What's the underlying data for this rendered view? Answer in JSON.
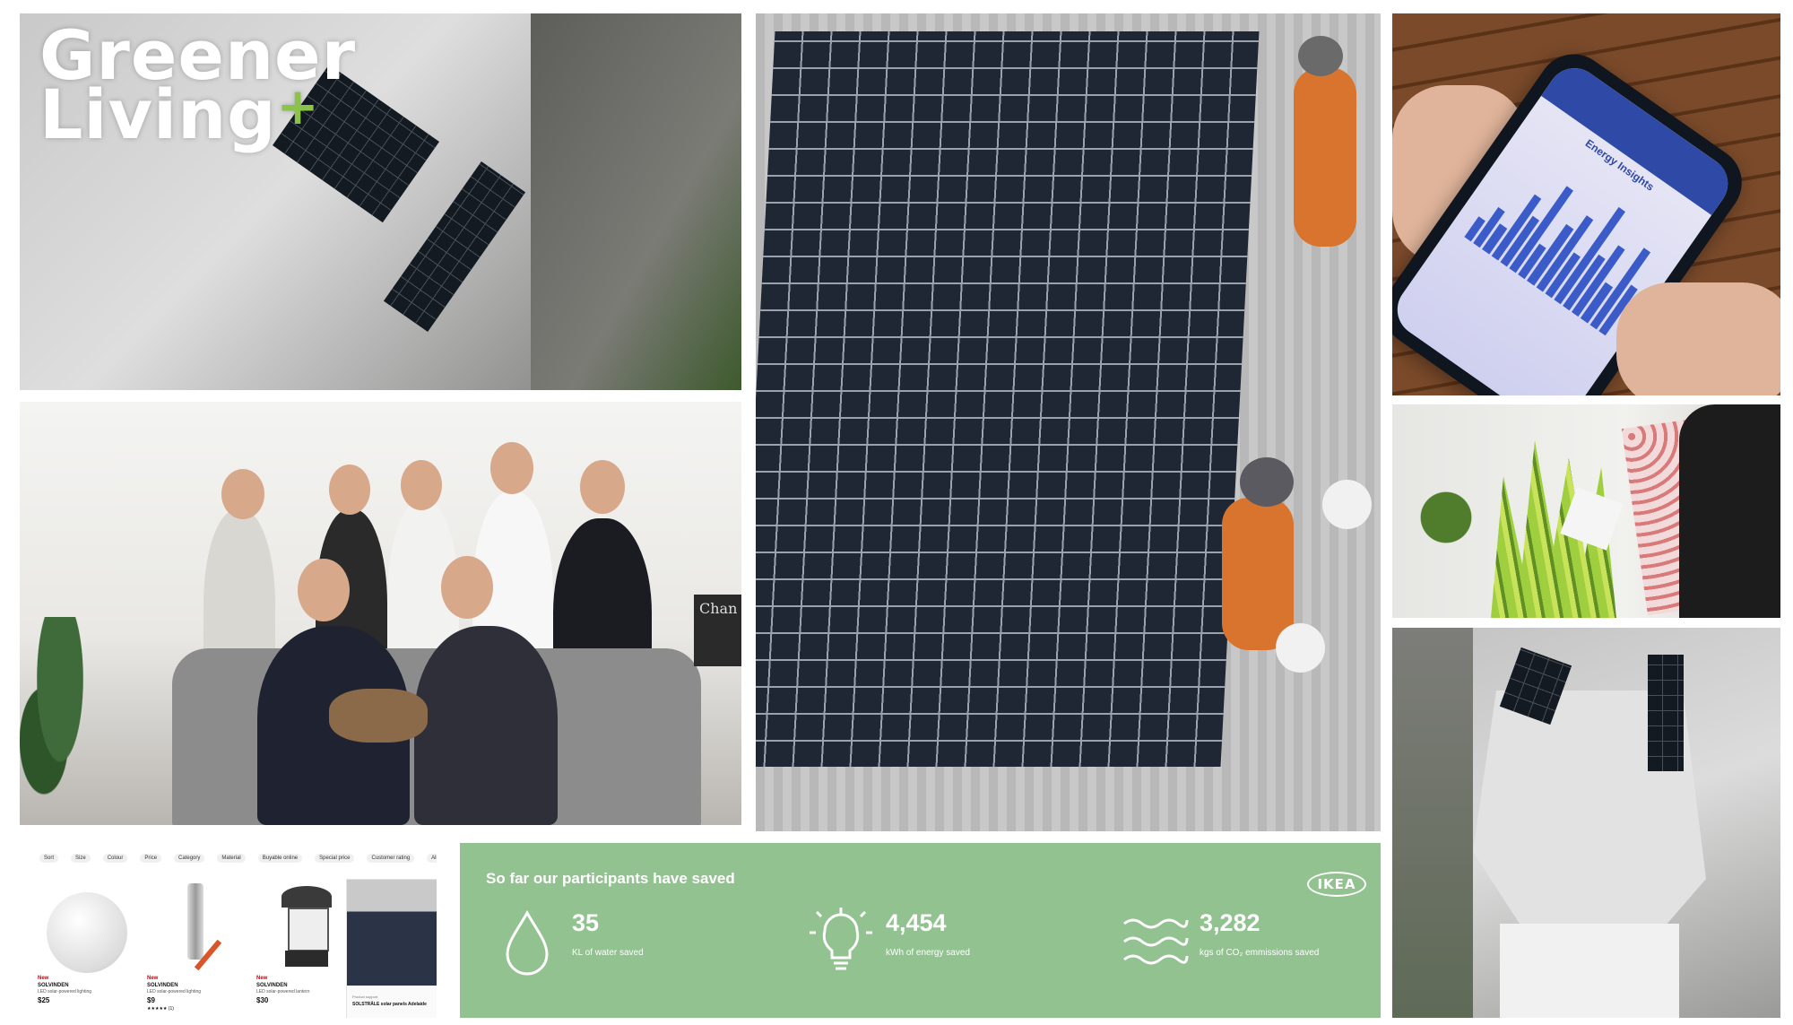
{
  "brand": {
    "title_line1": "Greener",
    "title_line2": "Living",
    "plus_glyph": "+",
    "accent": "#8bc24a"
  },
  "photos": {
    "roof_top": "",
    "family": "",
    "install": "",
    "phone": "",
    "plant": "",
    "house": ""
  },
  "family_scene": {
    "chalkboard_text": "Chan"
  },
  "phone_app": {
    "screen_title": "Energy Insights"
  },
  "product_strip": {
    "filters": [
      "Sort",
      "Size",
      "Colour",
      "Price",
      "Category",
      "Material",
      "Buyable online",
      "Special price",
      "Customer rating",
      "All filters"
    ],
    "products": [
      {
        "badge": "New",
        "name": "SOLVINDEN",
        "desc": "LED solar-powered lighting",
        "price": "$25",
        "rating": ""
      },
      {
        "badge": "New",
        "name": "SOLVINDEN",
        "desc": "LED solar-powered lighting",
        "price": "$9",
        "rating": "★★★★★ (1)"
      },
      {
        "badge": "New",
        "name": "SOLVINDEN",
        "desc": "LED solar-powered lantern",
        "price": "$30",
        "rating": ""
      }
    ],
    "card": {
      "note": "Product support",
      "name": "SOLSTRÅLE solar panels Adelaide"
    }
  },
  "stats": {
    "title": "So far our participants have saved",
    "logo": "IKEA",
    "bg_color": "#91c28f",
    "items": [
      {
        "icon": "water-drop-icon",
        "value": "35",
        "label": "KL of water saved"
      },
      {
        "icon": "lightbulb-icon",
        "value": "4,454",
        "label": "kWh of energy saved"
      },
      {
        "icon": "wind-waves-icon",
        "value": "3,282",
        "label": "kgs of CO₂ emmissions saved"
      }
    ]
  }
}
